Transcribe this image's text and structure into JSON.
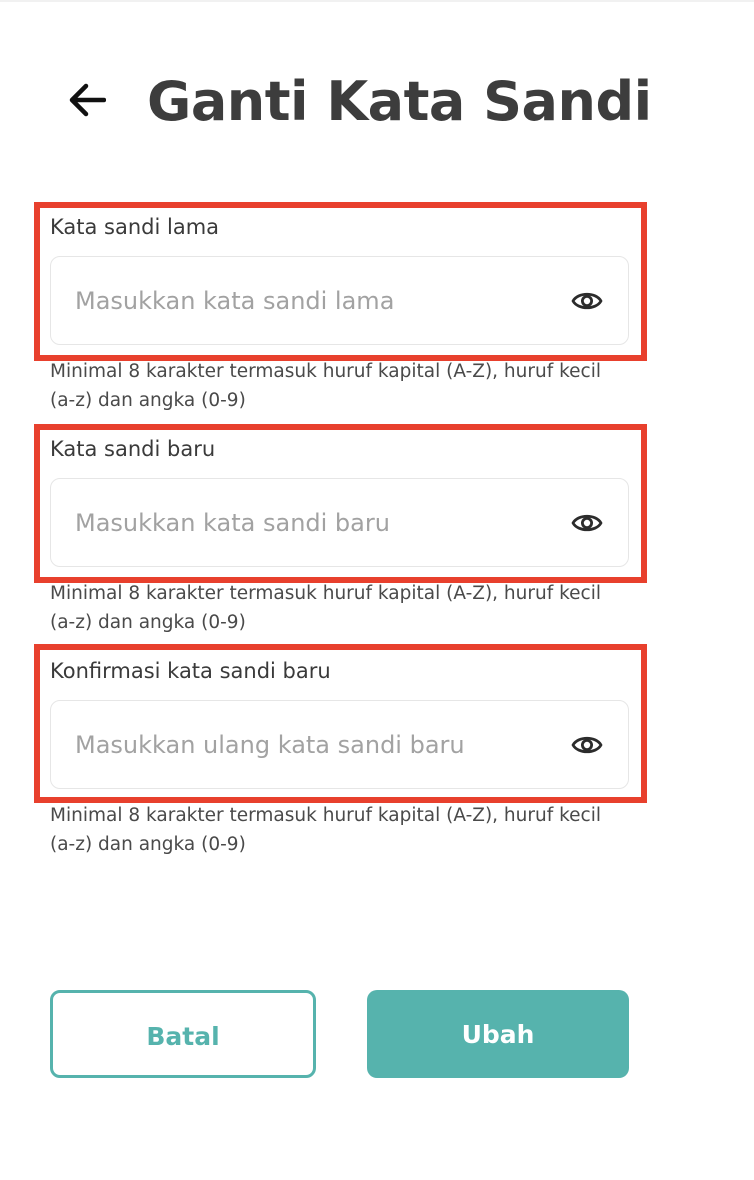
{
  "header": {
    "title": "Ganti Kata Sandi",
    "back_icon": "arrow-left-icon"
  },
  "form": {
    "fields": [
      {
        "label": "Kata sandi lama",
        "value": "",
        "placeholder": "Masukkan kata sandi lama",
        "hint": "Minimal 8 karakter termasuk huruf kapital (A-Z), huruf kecil (a-z) dan angka (0-9)",
        "icon": "eye-icon"
      },
      {
        "label": "Kata sandi baru",
        "value": "",
        "placeholder": "Masukkan kata sandi baru",
        "hint": "Minimal 8 karakter termasuk huruf kapital (A-Z), huruf kecil (a-z) dan angka (0-9)",
        "icon": "eye-icon"
      },
      {
        "label": "Konfirmasi kata sandi baru",
        "value": "",
        "placeholder": "Masukkan ulang kata sandi baru",
        "hint": "Minimal 8 karakter termasuk huruf kapital (A-Z), huruf kecil (a-z) dan angka (0-9)",
        "icon": "eye-icon"
      }
    ]
  },
  "actions": {
    "cancel_label": "Batal",
    "submit_label": "Ubah"
  },
  "colors": {
    "accent": "#56b3ad",
    "highlight_border": "#e8402d",
    "title_text": "#3d3d3d",
    "placeholder": "#a2a2a2"
  }
}
